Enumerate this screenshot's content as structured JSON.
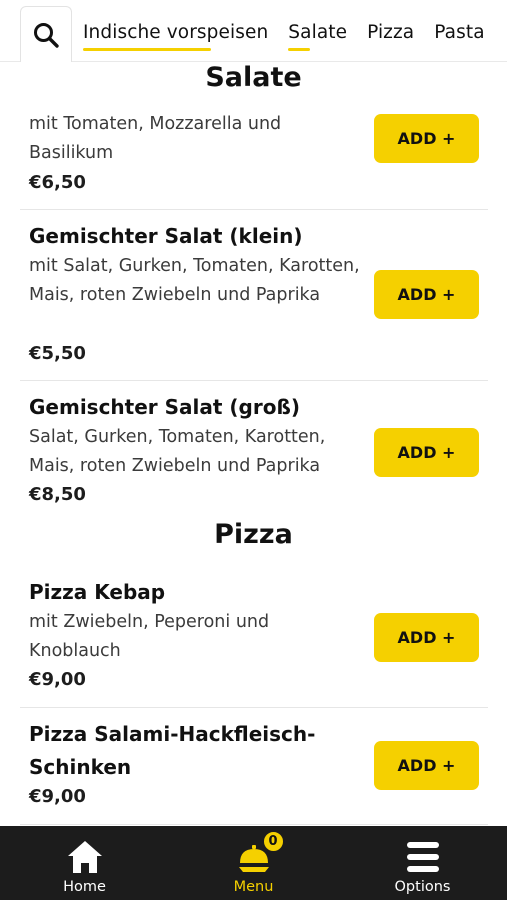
{
  "header": {
    "search_icon": "search-icon",
    "tabs": [
      {
        "label": "Indische vorspeisen",
        "active": false
      },
      {
        "label": "Salate",
        "active": true
      },
      {
        "label": "Pizza",
        "active": false
      },
      {
        "label": "Pasta",
        "active": false
      }
    ]
  },
  "sections": [
    {
      "title": "Salate",
      "items": [
        {
          "name": "",
          "description": "mit Tomaten, Mozzarella und Basilikum",
          "price": "€6,50",
          "add_label": "ADD +"
        },
        {
          "name": "Gemischter Salat (klein)",
          "description": "mit Salat, Gurken, Tomaten, Karotten, Mais, roten Zwiebeln und Paprika",
          "price": "€5,50",
          "add_label": "ADD +"
        },
        {
          "name": "Gemischter Salat (groß)",
          "description": "Salat, Gurken, Tomaten, Karotten, Mais, roten Zwiebeln und Paprika",
          "price": "€8,50",
          "add_label": "ADD +"
        }
      ]
    },
    {
      "title": "Pizza",
      "items": [
        {
          "name": "Pizza Kebap",
          "description": "mit Zwiebeln, Peperoni und Knoblauch",
          "price": "€9,00",
          "add_label": "ADD +"
        },
        {
          "name": "Pizza Salami-Hackfleisch-Schinken",
          "description": "",
          "price": "€9,00",
          "add_label": "ADD +"
        }
      ]
    }
  ],
  "bottom_nav": {
    "items": [
      {
        "label": "Home",
        "icon": "home-icon"
      },
      {
        "label": "Menu",
        "icon": "serving-bell-icon",
        "badge": "0",
        "active": true
      },
      {
        "label": "Options",
        "icon": "hamburger-menu-icon"
      }
    ]
  },
  "colors": {
    "accent": "#f5d000",
    "nav_background": "#1c1c1c",
    "text": "#111111"
  }
}
